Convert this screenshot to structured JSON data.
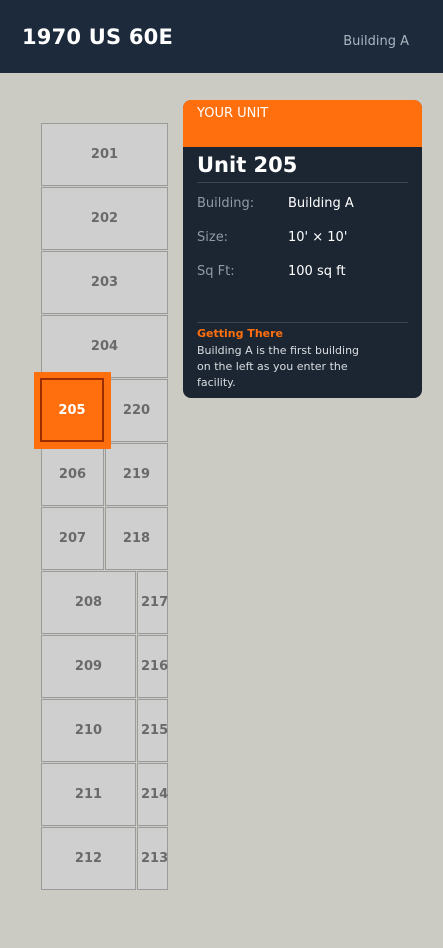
{
  "header": {
    "address": "1970 US 60E",
    "building": "Building A"
  },
  "units": {
    "201": "201",
    "202": "202",
    "203": "203",
    "204": "204",
    "205": "205",
    "206": "206",
    "207": "207",
    "208": "208",
    "209": "209",
    "210": "210",
    "211": "211",
    "212": "212",
    "213": "213",
    "214": "214",
    "215": "215",
    "216": "216",
    "217": "217",
    "218": "218",
    "219": "219",
    "220": "220"
  },
  "selected_unit": "205",
  "card": {
    "band_label": "YOUR UNIT",
    "title": "Unit 205",
    "building_label": "Building:",
    "building_value": "Building A",
    "size_label": "Size:",
    "size_value": "10' × 10'",
    "sqft_label": "Sq Ft:",
    "sqft_value": "100 sq ft",
    "getting_there_title": "Getting There",
    "getting_there_body": "Building A is the first building on the left as you enter the facility."
  },
  "colors": {
    "header_bg": "#1c2a3b",
    "accent": "#ff6f0d",
    "card_bg": "#1c2632",
    "page_bg": "#cbcbc4"
  }
}
